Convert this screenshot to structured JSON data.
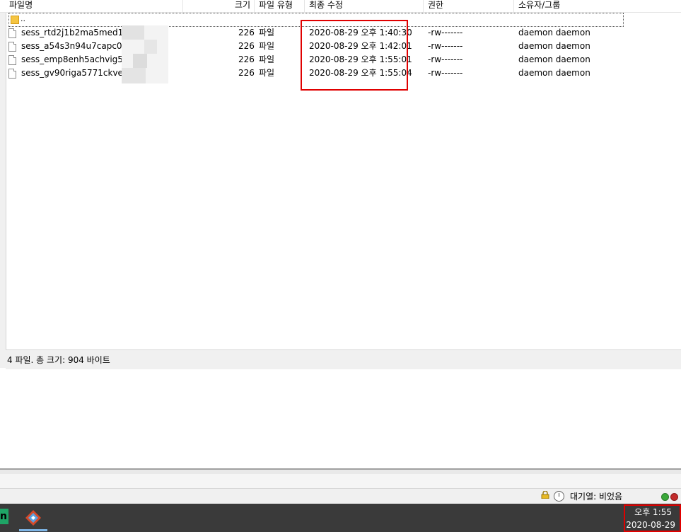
{
  "header": {
    "columns": [
      "파일명",
      "크기",
      "파일 유형",
      "최종 수정",
      "권한",
      "소유자/그룹"
    ]
  },
  "parent_dir": "..",
  "files": [
    {
      "name": "sess_rtd2j1b2ma5med1diq",
      "size": "226",
      "type": "파일",
      "modified": "2020-08-29 오후 1:40:30",
      "perms": "-rw-------",
      "owner": "daemon daemon"
    },
    {
      "name": "sess_a54s3n94u7capc0nc5",
      "size": "226",
      "type": "파일",
      "modified": "2020-08-29 오후 1:42:01",
      "perms": "-rw-------",
      "owner": "daemon daemon"
    },
    {
      "name": "sess_emp8enh5achvig5ba3",
      "size": "226",
      "type": "파일",
      "modified": "2020-08-29 오후 1:55:01",
      "perms": "-rw-------",
      "owner": "daemon daemon"
    },
    {
      "name": "sess_gv90riga5771ckvelnlir",
      "size": "226",
      "type": "파일",
      "modified": "2020-08-29 오후 1:55:04",
      "perms": "-rw-------",
      "owner": "daemon daemon"
    }
  ],
  "status": {
    "summary": "4 파일. 총 크기: 904 바이트"
  },
  "queue": {
    "label": "대기열: 비었음"
  },
  "taskbar": {
    "time": "오후 1:55",
    "date": "2020-08-29",
    "app_glyph": "n"
  },
  "colors": {
    "highlight_box": "#e00000",
    "taskbar_bg": "#3a3a3a",
    "status_green": "#3aa83a",
    "status_red": "#c22b2b"
  }
}
